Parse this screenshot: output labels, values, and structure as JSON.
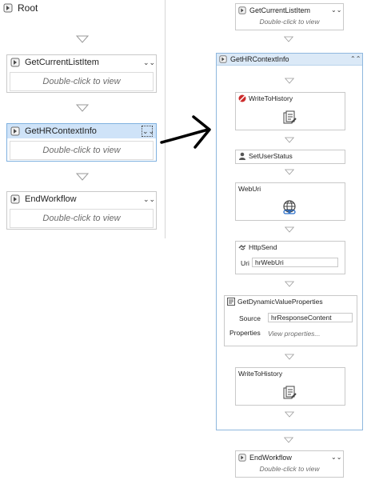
{
  "left": {
    "root_label": "Root",
    "activities": [
      {
        "title": "GetCurrentListItem",
        "body": "Double-click to view",
        "selected": false
      },
      {
        "title": "GetHRContextInfo",
        "body": "Double-click to view",
        "selected": true
      },
      {
        "title": "EndWorkflow",
        "body": "Double-click to view",
        "selected": false
      }
    ]
  },
  "right": {
    "top_activity": {
      "title": "GetCurrentListItem",
      "body": "Double-click to view"
    },
    "sequence": {
      "title": "GetHRContextInfo",
      "write_to_history_1": "WriteToHistory",
      "set_user_status": "SetUserStatus",
      "web_uri": "WebUri",
      "http_send": {
        "title": "HttpSend",
        "uri_label": "Uri",
        "uri_value": "hrWebUri"
      },
      "get_dynamic": {
        "title": "GetDynamicValueProperties",
        "source_label": "Source",
        "source_value": "hrResponseContent",
        "properties_label": "Properties",
        "properties_link": "View properties..."
      },
      "write_to_history_2": "WriteToHistory"
    },
    "bottom_activity": {
      "title": "EndWorkflow",
      "body": "Double-click to view"
    }
  },
  "colors": {
    "selected_header": "#cfe3f8",
    "sequence_border": "#8fb8de",
    "error_icon": "#cc2b2b"
  }
}
